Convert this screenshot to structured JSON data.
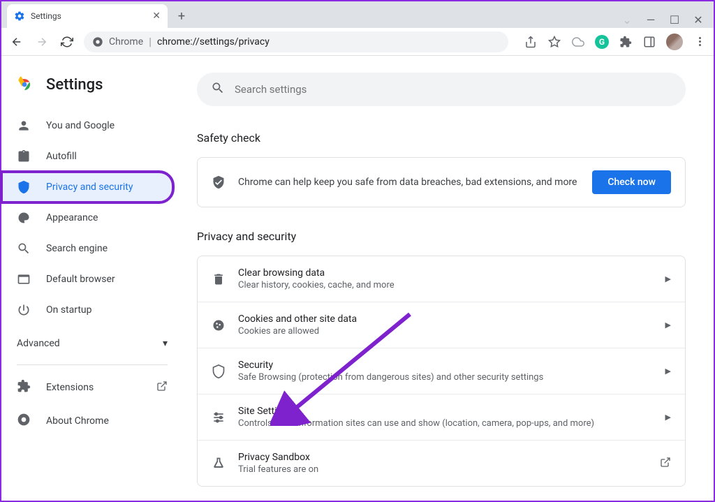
{
  "tab": {
    "title": "Settings"
  },
  "omnibox": {
    "prefix": "Chrome",
    "url": "chrome://settings/privacy"
  },
  "sidebar": {
    "title": "Settings",
    "items": [
      {
        "label": "You and Google"
      },
      {
        "label": "Autofill"
      },
      {
        "label": "Privacy and security"
      },
      {
        "label": "Appearance"
      },
      {
        "label": "Search engine"
      },
      {
        "label": "Default browser"
      },
      {
        "label": "On startup"
      }
    ],
    "advanced": "Advanced",
    "extensions": "Extensions",
    "about": "About Chrome"
  },
  "search": {
    "placeholder": "Search settings"
  },
  "safety": {
    "heading": "Safety check",
    "text": "Chrome can help keep you safe from data breaches, bad extensions, and more",
    "button": "Check now"
  },
  "privacy": {
    "heading": "Privacy and security",
    "rows": [
      {
        "title": "Clear browsing data",
        "sub": "Clear history, cookies, cache, and more"
      },
      {
        "title": "Cookies and other site data",
        "sub": "Cookies are allowed"
      },
      {
        "title": "Security",
        "sub": "Safe Browsing (protection from dangerous sites) and other security settings"
      },
      {
        "title": "Site Settings",
        "sub": "Controls what information sites can use and show (location, camera, pop-ups, and more)"
      },
      {
        "title": "Privacy Sandbox",
        "sub": "Trial features are on"
      }
    ]
  }
}
